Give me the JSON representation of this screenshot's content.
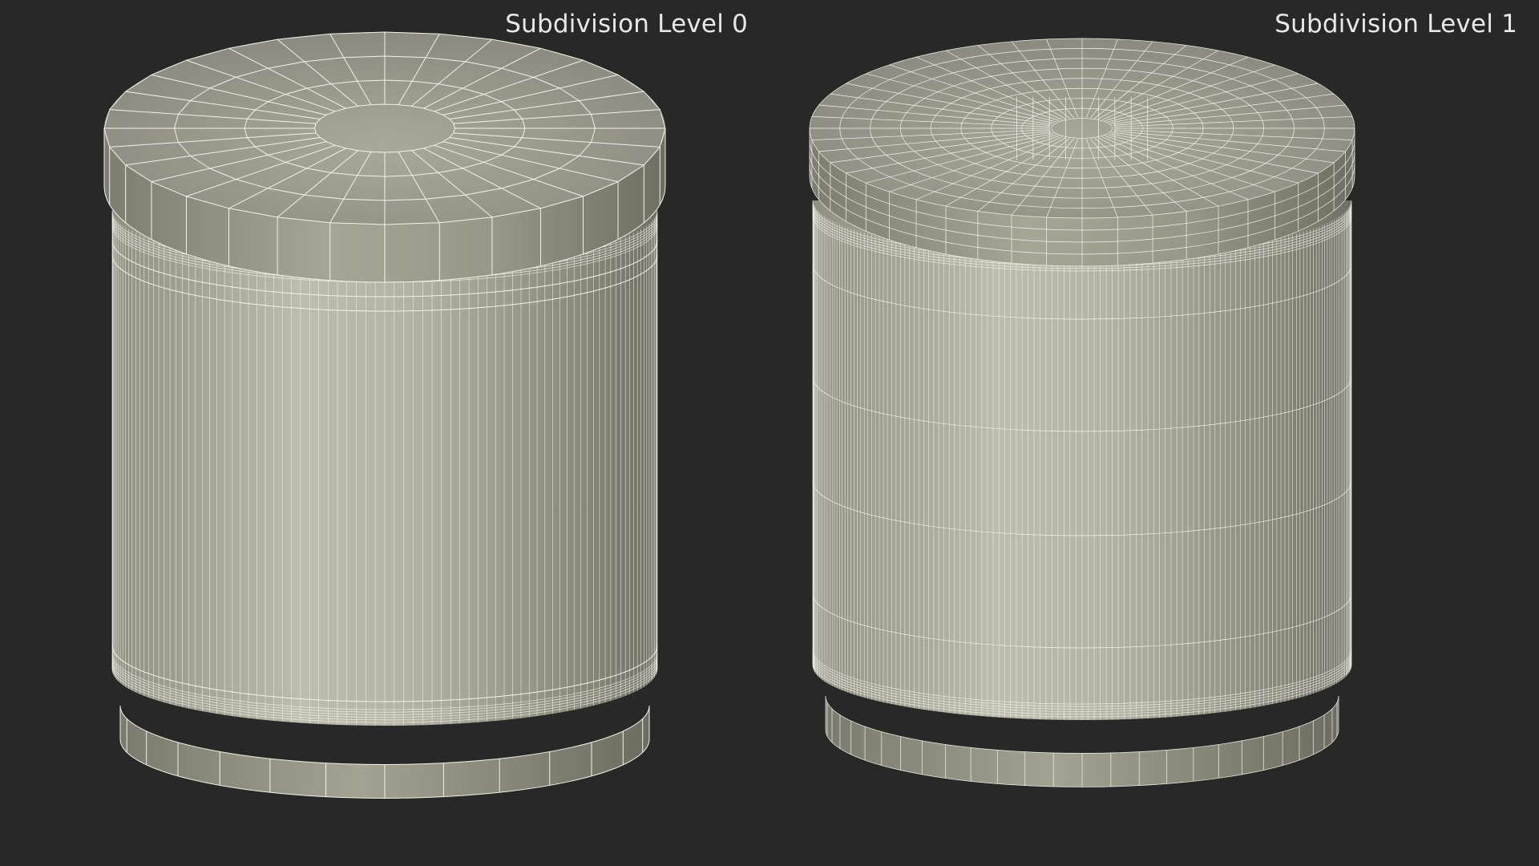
{
  "labels": {
    "level0": "Subdivision Level 0",
    "level1": "Subdivision Level 1"
  },
  "colors": {
    "background": "#282828",
    "surface_light": "#c2c2b4",
    "surface_mid": "#9d9d8e",
    "surface_dark": "#6c6c60",
    "wire": "#f2f2ea",
    "label_text": "#e8e8e8"
  },
  "objects": [
    {
      "name": "can-subdivision-level-0",
      "subdivision_level": 0
    },
    {
      "name": "can-subdivision-level-1",
      "subdivision_level": 1
    }
  ]
}
